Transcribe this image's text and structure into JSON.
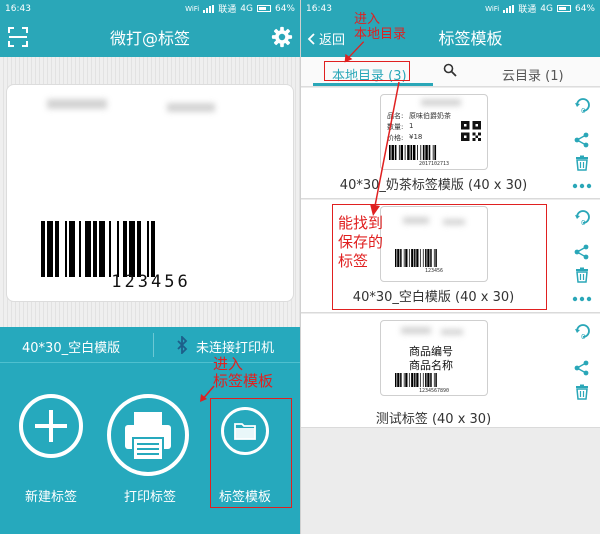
{
  "left": {
    "status": {
      "time": "16:43",
      "wifi": "WiFi",
      "carrier": "联通",
      "network": "4G",
      "battery": "64%"
    },
    "app_bar": {
      "title": "微打@标签",
      "scan_icon": "scan-icon",
      "settings_icon": "gear-icon"
    },
    "label_preview": {
      "barcode_number": "123456"
    },
    "info_bar": {
      "template_name": "40*30_空白模版",
      "printer_status": "未连接打印机"
    },
    "actions": [
      {
        "label": "新建标签",
        "icon": "plus-icon"
      },
      {
        "label": "打印标签",
        "icon": "printer-icon"
      },
      {
        "label": "标签模板",
        "icon": "folder-icon"
      }
    ],
    "annotation": {
      "line1": "进入",
      "line2": "标签模板"
    }
  },
  "right": {
    "status": {
      "time": "16:43",
      "wifi": "WiFi",
      "carrier": "联通",
      "network": "4G",
      "battery": "64%"
    },
    "app_bar": {
      "back_label": "返回",
      "title": "标签模板"
    },
    "tabs": {
      "local": "本地目录 (3)",
      "search_icon": "search-icon",
      "cloud": "云目录 (1)"
    },
    "annotation_top": {
      "line1": "进入",
      "line2": "本地目录"
    },
    "annotation_mid": {
      "line1": "能找到",
      "line2": "保存的",
      "line3": "标签"
    },
    "templates": [
      {
        "name": "40*30_奶茶标签模版 (40 x 30)",
        "fields": [
          {
            "label": "品名:",
            "value": "原味伯爵奶茶"
          },
          {
            "label": "数量:",
            "value": "1"
          },
          {
            "label": "价格:",
            "value": "¥18"
          }
        ],
        "barcode_number": "2017102713"
      },
      {
        "name": "40*30_空白模版 (40 x 30)",
        "barcode_number": "123456"
      },
      {
        "name": "测试标签 (40 x 30)",
        "lines": [
          "商品编号",
          "商品名称"
        ],
        "barcode_number": "1234567890"
      }
    ]
  },
  "colors": {
    "primary": "#2aa7b8",
    "bottom_panel": "#26a9bd",
    "annotation": "#e02020"
  }
}
